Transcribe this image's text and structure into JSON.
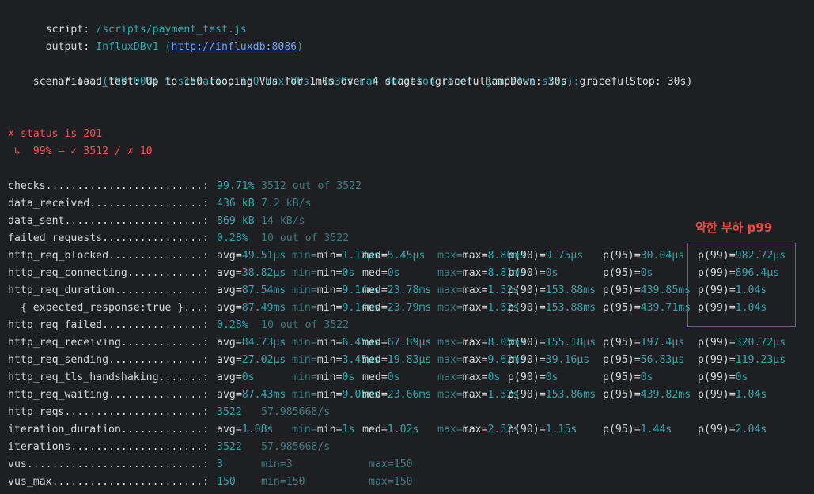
{
  "header": {
    "script_key": "  script: ",
    "script_val": "/scripts/payment_test.js",
    "output_key": "  output: ",
    "output_val": "InfluxDBv1 (",
    "output_url": "http://influxdb:8086",
    "output_close": ")"
  },
  "scenarios": {
    "key": "scenarios: ",
    "summary": "(100.00%) 1 scenario, 150 max VUs, 1m30s max duration (incl. graceful stop):",
    "detail": "         * load_test: Up to 150 looping VUs for 1m0s over 4 stages (gracefulRampDown: 30s, gracefulStop: 30s)"
  },
  "check": {
    "title": "✗ status is 201",
    "result": " ↳  99% — ✓ 3512 / ✗ 10"
  },
  "annotation": {
    "label": "약한 부하 p99",
    "color": "#e5382c"
  },
  "metrics": [
    {
      "name": "checks.........................:",
      "val": "99.71%",
      "extra": "3512 out of 3522"
    },
    {
      "name": "data_received..................:",
      "val": "436 kB",
      "extra": "7.2 kB/s"
    },
    {
      "name": "data_sent......................:",
      "val": "869 kB",
      "extra": "14 kB/s"
    },
    {
      "name": "failed_requests................:",
      "val": "0.28%",
      "extra": "10 out of 3522"
    },
    {
      "name": "http_req_blocked...............:",
      "avg": "49.51µs",
      "min": "1.12µs",
      "med": "5.45µs",
      "max": "8.86ms",
      "p90": "9.75µs",
      "p95": "30.04µs",
      "p99": "982.72µs"
    },
    {
      "name": "http_req_connecting............:",
      "avg": "38.82µs",
      "min": "0s",
      "med": "0s",
      "max": "8.81ms",
      "p90": "0s",
      "p95": "0s",
      "p99": "896.4µs"
    },
    {
      "name": "http_req_duration..............:",
      "avg": "87.54ms",
      "min": "9.14ms",
      "med": "23.78ms",
      "max": "1.52s",
      "p90": "153.88ms",
      "p95": "439.85ms",
      "p99": "1.04s"
    },
    {
      "name": "  { expected_response:true }...:",
      "avg": "87.49ms",
      "min": "9.14ms",
      "med": "23.79ms",
      "max": "1.52s",
      "p90": "153.88ms",
      "p95": "439.71ms",
      "p99": "1.04s"
    },
    {
      "name": "http_req_failed................:",
      "val": "0.28%",
      "extra": "10 out of 3522"
    },
    {
      "name": "http_req_receiving.............:",
      "avg": "84.73µs",
      "min": "6.45µs",
      "med": "67.89µs",
      "max": "8.05ms",
      "p90": "155.18µs",
      "p95": "197.4µs",
      "p99": "320.72µs"
    },
    {
      "name": "http_req_sending...............:",
      "avg": "27.02µs",
      "min": "3.45µs",
      "med": "19.83µs",
      "max": "9.62ms",
      "p90": "39.16µs",
      "p95": "56.83µs",
      "p99": "119.23µs"
    },
    {
      "name": "http_req_tls_handshaking.......:",
      "avg": "0s",
      "min": "0s",
      "med": "0s",
      "max": "0s",
      "p90": "0s",
      "p95": "0s",
      "p99": "0s"
    },
    {
      "name": "http_req_waiting...............:",
      "avg": "87.43ms",
      "min": "9.06ms",
      "med": "23.66ms",
      "max": "1.52s",
      "p90": "153.86ms",
      "p95": "439.82ms",
      "p99": "1.04s"
    },
    {
      "name": "http_reqs......................:",
      "val": "3522",
      "extra": "57.985668/s"
    },
    {
      "name": "iteration_duration.............:",
      "avg": "1.08s",
      "min": "1s",
      "med": "1.02s",
      "max": "2.52s",
      "p90": "1.15s",
      "p95": "1.44s",
      "p99": "2.04s"
    },
    {
      "name": "iterations.....................:",
      "val": "3522",
      "extra": "57.985668/s"
    },
    {
      "name": "vus............................:",
      "val": "3",
      "vmin": "3",
      "vmax": "150"
    },
    {
      "name": "vus_max........................:",
      "val": "150",
      "vmin": "150",
      "vmax": "150"
    }
  ]
}
